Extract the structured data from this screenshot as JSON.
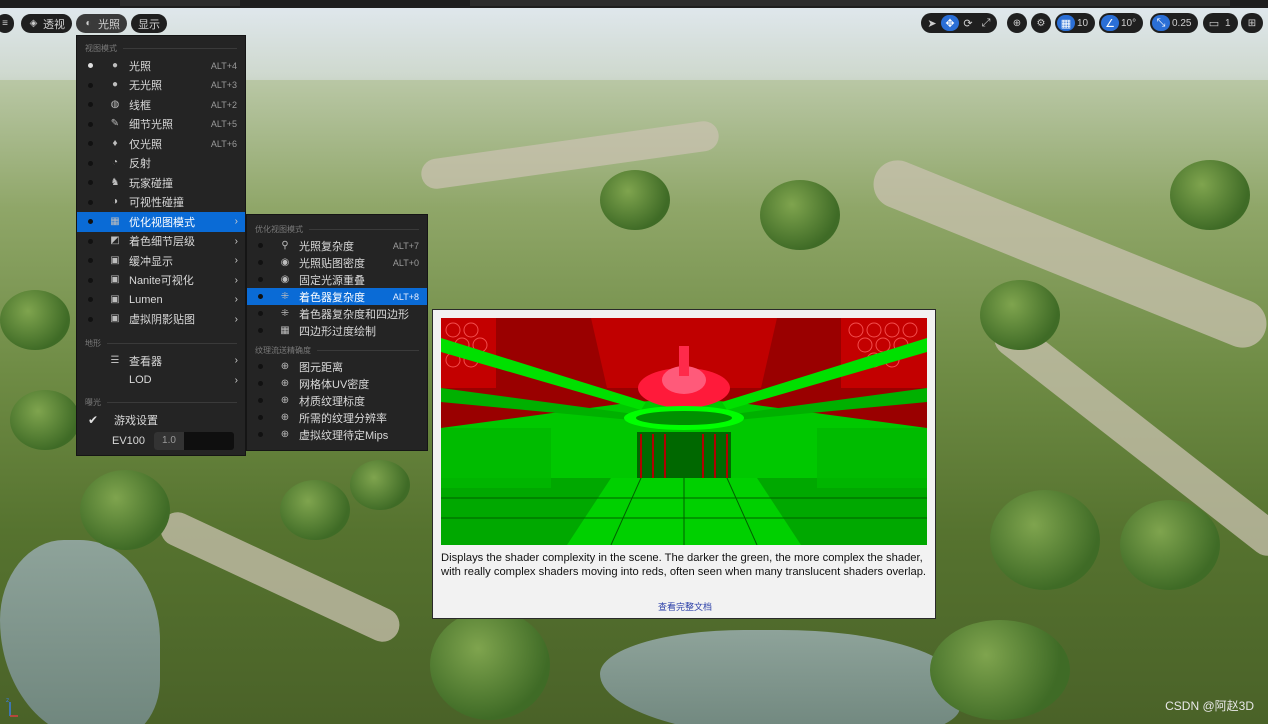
{
  "toolbar": {
    "menu_icon": "hamburger-icon",
    "perspective_label": "透视",
    "lighting_label": "光照",
    "show_label": "显示",
    "grid_snap_value": "10",
    "rotation_snap_value": "10°",
    "scale_snap_value": "0.25",
    "camera_speed_value": "1"
  },
  "view_mode_menu": {
    "section_view_modes": "视图模式",
    "items": [
      {
        "label": "光照",
        "shortcut": "ALT+4",
        "icon": "lit-sphere-icon",
        "selected": true
      },
      {
        "label": "无光照",
        "shortcut": "ALT+3",
        "icon": "unlit-sphere-icon",
        "selected": false
      },
      {
        "label": "线框",
        "shortcut": "ALT+2",
        "icon": "wireframe-sphere-icon",
        "selected": false
      },
      {
        "label": "细节光照",
        "shortcut": "ALT+5",
        "icon": "detail-lighting-icon",
        "selected": false
      },
      {
        "label": "仅光照",
        "shortcut": "ALT+6",
        "icon": "lightbulb-icon",
        "selected": false
      },
      {
        "label": "反射",
        "shortcut": "",
        "icon": "reflection-icon",
        "selected": false
      },
      {
        "label": "玩家碰撞",
        "shortcut": "",
        "icon": "player-collision-icon",
        "selected": false
      },
      {
        "label": "可视性碰撞",
        "shortcut": "",
        "icon": "visibility-collision-icon",
        "selected": false
      }
    ],
    "submenus": [
      {
        "label": "优化视图模式",
        "icon": "optimization-grid-icon",
        "highlighted": true
      },
      {
        "label": "着色细节层级",
        "icon": "lod-coloration-icon",
        "highlighted": false
      },
      {
        "label": "缓冲显示",
        "icon": "buffer-icon",
        "highlighted": false
      },
      {
        "label": "Nanite可视化",
        "icon": "nanite-icon",
        "highlighted": false
      },
      {
        "label": "Lumen",
        "icon": "lumen-icon",
        "highlighted": false
      },
      {
        "label": "虚拟阴影贴图",
        "icon": "virtual-shadow-map-icon",
        "highlighted": false
      }
    ],
    "section_landscape": "地形",
    "landscape_items": [
      {
        "label": "查看器",
        "icon": "viewer-icon"
      },
      {
        "label": "LOD",
        "icon": ""
      }
    ],
    "section_exposure": "曝光",
    "game_settings_label": "游戏设置",
    "ev100_label": "EV100",
    "ev100_value": "1.0"
  },
  "optimization_menu": {
    "section_title": "优化视图模式",
    "items": [
      {
        "label": "光照复杂度",
        "shortcut": "ALT+7",
        "highlighted": false
      },
      {
        "label": "光照贴图密度",
        "shortcut": "ALT+0",
        "highlighted": false
      },
      {
        "label": "固定光源重叠",
        "shortcut": "",
        "highlighted": false
      },
      {
        "label": "着色器复杂度",
        "shortcut": "ALT+8",
        "highlighted": true
      },
      {
        "label": "着色器复杂度和四边形",
        "shortcut": "",
        "highlighted": false
      },
      {
        "label": "四边形过度绘制",
        "shortcut": "",
        "highlighted": false
      }
    ],
    "section_texture": "纹理流送精确度",
    "texture_items": [
      {
        "label": "图元距离"
      },
      {
        "label": "网格体UV密度"
      },
      {
        "label": "材质纹理标度"
      },
      {
        "label": "所需的纹理分辨率"
      },
      {
        "label": "虚拟纹理待定Mips"
      }
    ]
  },
  "tooltip": {
    "description": "Displays the shader complexity in the scene. The darker the green, the more complex the shader, with really complex shaders moving into reds, often seen when many translucent shaders overlap.",
    "link": "查看完整文档"
  },
  "watermark": "CSDN @阿赵3D",
  "colors": {
    "accent": "#0a6bd6",
    "menu_bg": "#242424",
    "shader_green": "#00c800",
    "shader_red": "#c80000"
  }
}
